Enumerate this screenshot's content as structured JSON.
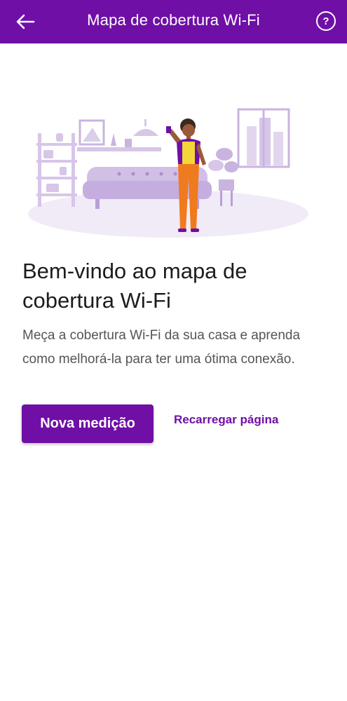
{
  "app_bar": {
    "title": "Mapa de cobertura Wi-Fi",
    "back_icon": "arrow-left-icon",
    "help_icon": "help-circle-icon",
    "help_glyph": "?"
  },
  "colors": {
    "brand": "#6f0fa6",
    "illustration_light": "#e6dcf0",
    "illustration_mid": "#c9b4df",
    "person_pants": "#f07a1e",
    "person_shirt": "#f4d63a"
  },
  "content": {
    "title": "Bem-vindo ao mapa de cobertura Wi-Fi",
    "description": "Meça a cobertura Wi-Fi da sua casa e aprenda como melhorá-la para ter uma ótima conexão."
  },
  "actions": {
    "primary_label": "Nova medição",
    "secondary_label": "Recarregar página"
  }
}
